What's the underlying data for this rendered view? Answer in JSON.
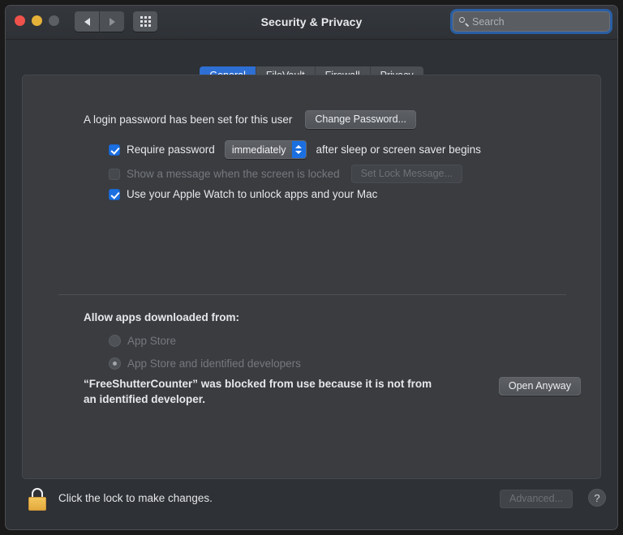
{
  "window": {
    "title": "Security & Privacy",
    "traffic_lights": [
      "close",
      "minimize",
      "zoom"
    ],
    "nav": {
      "back": "back-chevron",
      "forward": "forward-chevron",
      "show_all": "grid-icon"
    },
    "colors": {
      "accent_blue": "#1b6fe0",
      "tab_selected": "#2e6fd4",
      "window_bg": "#2e3135",
      "panel_bg": "#3a3c40",
      "lock_gold": "#e3a93c"
    }
  },
  "search": {
    "placeholder": "Search",
    "value": "",
    "icon": "search-icon"
  },
  "tabs": [
    {
      "label": "General",
      "selected": true
    },
    {
      "label": "FileVault",
      "selected": false
    },
    {
      "label": "Firewall",
      "selected": false
    },
    {
      "label": "Privacy",
      "selected": false
    }
  ],
  "general": {
    "login_password_text": "A login password has been set for this user",
    "change_password_button": "Change Password...",
    "require_password": {
      "checked": true,
      "label_before": "Require password",
      "delay_value": "immediately",
      "label_after": "after sleep or screen saver begins"
    },
    "lock_message": {
      "checked": false,
      "enabled": false,
      "label": "Show a message when the screen is locked",
      "button": "Set Lock Message..."
    },
    "apple_watch": {
      "checked": true,
      "label": "Use your Apple Watch to unlock apps and your Mac"
    },
    "allow_apps": {
      "heading": "Allow apps downloaded from:",
      "enabled": false,
      "options": [
        {
          "label": "App Store",
          "selected": false
        },
        {
          "label": "App Store and identified developers",
          "selected": true
        }
      ]
    },
    "blocked_notice": {
      "line1": "“FreeShutterCounter” was blocked from use because it is not from",
      "line2": "an identified developer.",
      "button": "Open Anyway"
    }
  },
  "footer": {
    "lock_icon": "lock-closed-icon",
    "lock_text": "Click the lock to make changes.",
    "advanced_button": "Advanced...",
    "advanced_enabled": false,
    "help_button": "?"
  }
}
